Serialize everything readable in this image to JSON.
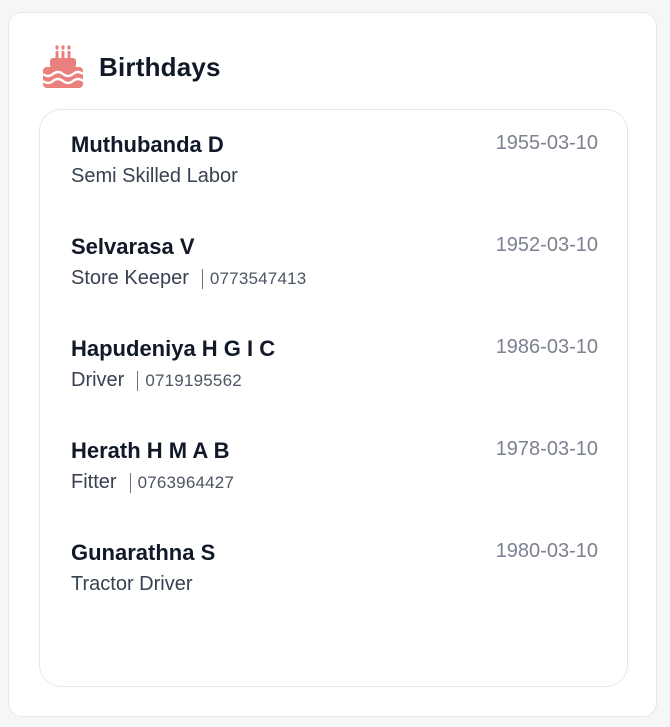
{
  "widget": {
    "title": "Birthdays",
    "icon": "birthday-cake-icon",
    "accent_color": "#e9807d"
  },
  "birthdays": [
    {
      "name": "Muthubanda D",
      "role": "Semi Skilled Labor",
      "phone": "",
      "date": "1955-03-10"
    },
    {
      "name": "Selvarasa V",
      "role": "Store Keeper",
      "phone": "0773547413",
      "date": "1952-03-10"
    },
    {
      "name": "Hapudeniya H G I C",
      "role": "Driver",
      "phone": "0719195562",
      "date": "1986-03-10"
    },
    {
      "name": "Herath H M A B",
      "role": "Fitter",
      "phone": "0763964427",
      "date": "1978-03-10"
    },
    {
      "name": "Gunarathna S",
      "role": "Tractor Driver",
      "phone": "",
      "date": "1980-03-10"
    }
  ]
}
